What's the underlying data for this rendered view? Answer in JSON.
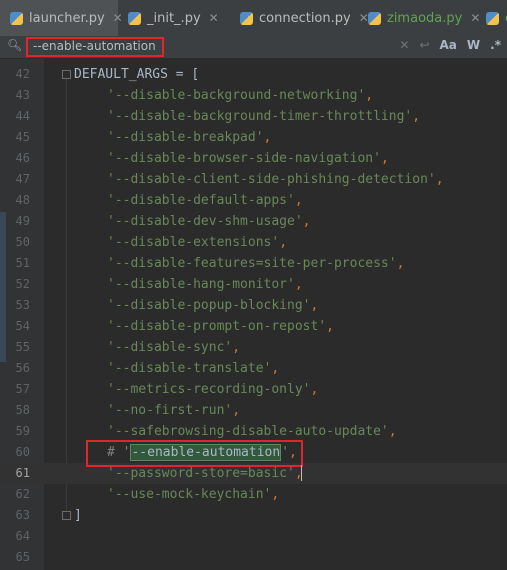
{
  "tabs": [
    {
      "label": "launcher.py",
      "active": true
    },
    {
      "label": "_init_.py",
      "active": false
    },
    {
      "label": "connection.py",
      "active": false
    },
    {
      "label": "zimaoda.py",
      "active": false,
      "vcs_added": true
    },
    {
      "label": "c",
      "active": false
    }
  ],
  "search": {
    "query": "--enable-automation",
    "icon": "search-icon",
    "tools": [
      "Aa",
      "W",
      ".*"
    ]
  },
  "colors": {
    "keyword": "#cc7832",
    "string": "#6a8759",
    "comment": "#808080",
    "highlight_border": "#e0262a",
    "match_background": "#32593d"
  },
  "editor": {
    "lines": [
      {
        "num": "42",
        "text": "DEFAULT_ARGS = ["
      },
      {
        "num": "43",
        "text": "'--disable-background-networking'"
      },
      {
        "num": "44",
        "text": "'--disable-background-timer-throttling'"
      },
      {
        "num": "45",
        "text": "'--disable-breakpad'"
      },
      {
        "num": "46",
        "text": "'--disable-browser-side-navigation'"
      },
      {
        "num": "47",
        "text": "'--disable-client-side-phishing-detection'"
      },
      {
        "num": "48",
        "text": "'--disable-default-apps'"
      },
      {
        "num": "49",
        "text": "'--disable-dev-shm-usage'"
      },
      {
        "num": "50",
        "text": "'--disable-extensions'"
      },
      {
        "num": "51",
        "text": "'--disable-features=site-per-process'"
      },
      {
        "num": "52",
        "text": "'--disable-hang-monitor'"
      },
      {
        "num": "53",
        "text": "'--disable-popup-blocking'"
      },
      {
        "num": "54",
        "text": "'--disable-prompt-on-repost'"
      },
      {
        "num": "55",
        "text": "'--disable-sync'"
      },
      {
        "num": "56",
        "text": "'--disable-translate'"
      },
      {
        "num": "57",
        "text": "'--metrics-recording-only'"
      },
      {
        "num": "58",
        "text": "'--no-first-run'"
      },
      {
        "num": "59",
        "text": "'--safebrowsing-disable-auto-update'"
      },
      {
        "num": "60",
        "comment": true,
        "pre": "# '",
        "match": "--enable-automation",
        "post": "'"
      },
      {
        "num": "61",
        "text": "'--password-store=basic'",
        "current": true
      },
      {
        "num": "62",
        "text": "'--use-mock-keychain'"
      },
      {
        "num": "63",
        "text": "]"
      },
      {
        "num": "64",
        "text": ""
      },
      {
        "num": "65",
        "text": ""
      }
    ]
  }
}
